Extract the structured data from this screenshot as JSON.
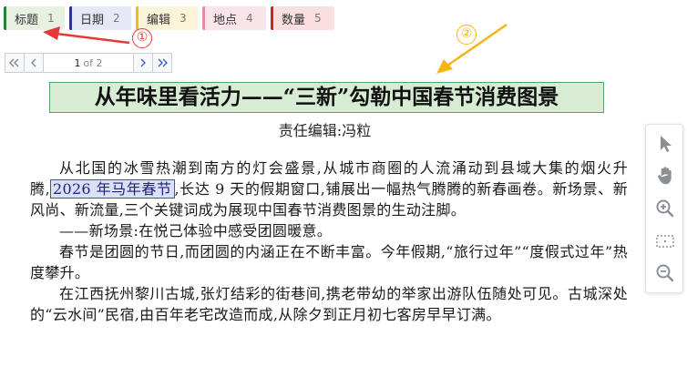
{
  "tabs": [
    {
      "label": "标题",
      "num": "1"
    },
    {
      "label": "日期",
      "num": "2"
    },
    {
      "label": "编辑",
      "num": "3"
    },
    {
      "label": "地点",
      "num": "4"
    },
    {
      "label": "数量",
      "num": "5"
    }
  ],
  "pager": {
    "current": "1",
    "of_text": "of 2"
  },
  "doc": {
    "title": "从年味里看活力——“三新”勾勒中国春节消费图景",
    "editor": "责任编辑:冯粒",
    "p1_before": "从北国的冰雪热潮到南方的灯会盛景,从城市商圈的人流涌动到县域大集的烟火升腾,",
    "p1_date": "2026 年马年春节",
    "p1_after": ",长达 9 天的假期窗口,铺展出一幅热气腾腾的新春画卷。新场景、新风尚、新流量,三个关键词成为展现中国春节消费图景的生动注脚。",
    "p2": "——新场景:在悦己体验中感受团圆暖意。",
    "p3": "春节是团圆的节日,而团圆的内涵正在不断丰富。今年假期,“旅行过年”“度假式过年”热度攀升。",
    "p4": "在江西抚州黎川古城,张灯结彩的街巷间,携老带幼的举家出游队伍随处可见。古城深处的“云水间”民宿,由百年老宅改造而成,从除夕到正月初七客房早早订满。"
  },
  "annotations": {
    "marker1": "①",
    "marker2": "②"
  },
  "colors": {
    "arrow1": "#e53935",
    "arrow2": "#f5b50e",
    "title_border": "#53a35d",
    "date_border": "#3f51b5"
  },
  "tools": [
    "pointer-icon",
    "hand-icon",
    "zoom-in-icon",
    "fit-page-icon",
    "zoom-out-icon"
  ]
}
